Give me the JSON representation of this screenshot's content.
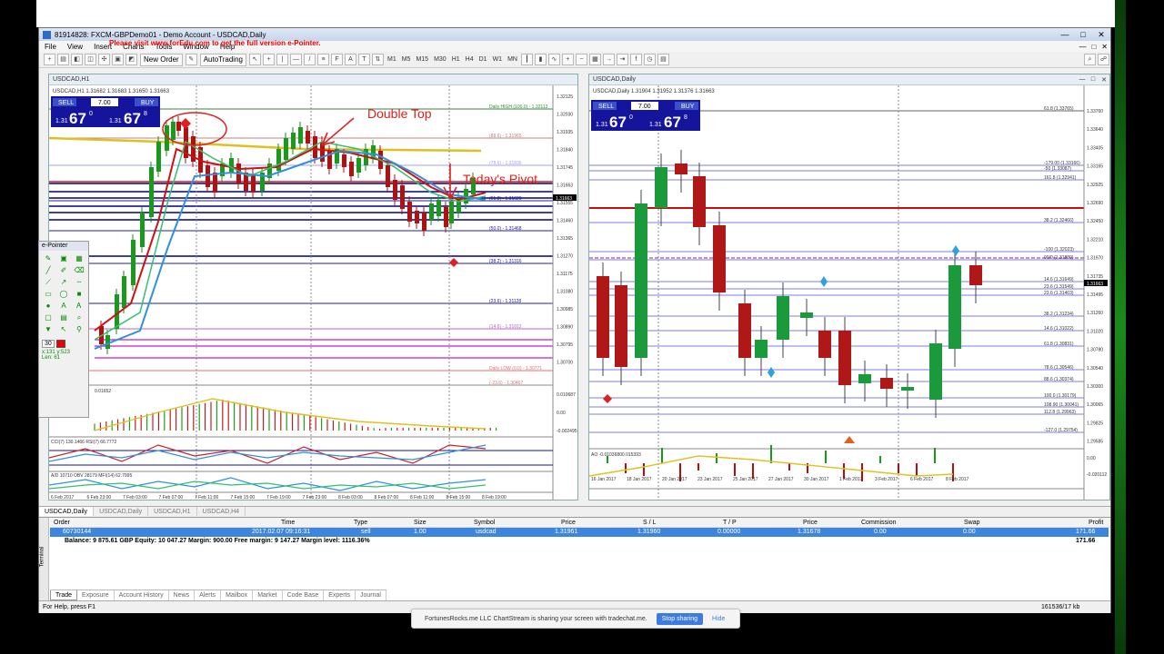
{
  "window": {
    "title": "81914828: FXCM-GBPDemo01 - Demo Account - USDCAD,Daily",
    "controls": [
      "—",
      "□",
      "✕"
    ]
  },
  "menu": [
    "File",
    "View",
    "Insert",
    "Charts",
    "Tools",
    "Window",
    "Help"
  ],
  "toolbar": {
    "new_order": "New Order",
    "auto_trading": "AutoTrading",
    "timeframes": [
      "M1",
      "M5",
      "M15",
      "M30",
      "H1",
      "H4",
      "D1",
      "W1",
      "MN"
    ]
  },
  "promo_text": "Please visit www.forEdu.com to get the full version e-Pointer.",
  "chart_h1": {
    "title": "USDCAD,H1",
    "symbol_label": "USDCAD,H1  1.31682 1.31683 1.31650 1.31663",
    "sell": "SELL",
    "buy": "BUY",
    "lot": "7.00",
    "sell_price_small": "1.31",
    "sell_price_big": "67",
    "sell_price_sup": "0",
    "buy_price_small": "1.31",
    "buy_price_big": "67",
    "buy_price_sup": "8",
    "annotation_double_top": "Double Top",
    "annotation_pivot": "Today's Pivot",
    "price_axis": [
      "1.32125",
      "1.32030",
      "1.31935",
      "1.31840",
      "1.31745",
      "1.31663",
      "1.31555",
      "1.31460",
      "1.31365",
      "1.31270",
      "1.31175",
      "1.31080",
      "1.30985",
      "1.30890",
      "1.30795",
      "1.30700"
    ],
    "level_labels": [
      "Daily HIGH (100.0) - 1.32113",
      "(88.6) - 1.31965",
      "(78.6) - 1.31836",
      "(61.8) - 1.31620",
      "(50.0) - 1.31468",
      "(38.2) - 1.31316",
      "(23.6) - 1.31128",
      "(14.6) - 1.31012",
      "Daily LOW (0.0) - 1.30771",
      "(-23.6) - 1.30467"
    ],
    "osc_label": "0.01652",
    "osc_axis": [
      "0.010687",
      "0.00",
      "-0.002495"
    ],
    "cci_label": "CCI(7) 130.1466  RSI(7) 66.7772",
    "obv_label": "A/D 10710  OBV 28179  MFI(14) 62.7995",
    "time_axis": [
      "6 Feb 2017",
      "6 Feb 23:00",
      "7 Feb 03:00",
      "7 Feb 07:00",
      "7 Feb 11:00",
      "7 Feb 15:00",
      "7 Feb 19:00",
      "7 Feb 23:00",
      "8 Feb 03:00",
      "8 Feb 07:00",
      "8 Feb 11:00",
      "8 Feb 15:00",
      "8 Feb 19:00"
    ]
  },
  "chart_daily": {
    "title": "USDCAD,Daily",
    "symbol_label": "USDCAD,Daily  1.31904 1.31952 1.31376 1.31663",
    "sell": "SELL",
    "buy": "BUY",
    "lot": "7.00",
    "sell_price_small": "1.31",
    "sell_price_big": "67",
    "sell_price_sup": "0",
    "buy_price_small": "1.31",
    "buy_price_big": "67",
    "buy_price_sup": "8",
    "price_axis": [
      "1.33760",
      "1.33640",
      "1.33405",
      "1.33165",
      "1.32925",
      "1.32690",
      "1.32450",
      "1.32210",
      "1.31970",
      "1.31735",
      "1.31495",
      "1.31260",
      "1.31020",
      "1.30780",
      "1.30540",
      "1.30300",
      "1.30065",
      "1.29825",
      "1.29585"
    ],
    "level_labels": [
      "61.8 (1.33765)",
      "-179.00 (1.33166)",
      "-50 (1.33087)",
      "161.8 (1.32941)",
      "38.2 (1.32466)",
      "-100 (1.32023)",
      "00/0 (1.31880)",
      "14.6 (1.31649)",
      "23.6 (1.31549)",
      "23.6 (1.31403)",
      "38.2 (1.31234)",
      "14.6 (1.31022)",
      "61.8 (1.30831)",
      "78.6 (1.30546)",
      "88.6 (1.30374)",
      "100.0 (1.30179)",
      "108.90 (1.30041)",
      "112.8 (1.29963)",
      "-127.0 (1.29754)"
    ],
    "ao_label": "AO -0.01036800.015393",
    "ao_axis": [
      "0.00",
      "-0.020112"
    ],
    "time_axis": [
      "16 Jan 2017",
      "18 Jan 2017",
      "20 Jan 2017",
      "23 Jan 2017",
      "25 Jan 2017",
      "27 Jan 2017",
      "30 Jan 2017",
      "1 Feb 2017",
      "3 Feb 2017",
      "6 Feb 2017",
      "8 Feb 2017"
    ]
  },
  "chart_tabs": [
    "USDCAD,Daily",
    "USDCAD,Daily",
    "USDCAD,H1",
    "USDCAD,H4"
  ],
  "terminal": {
    "columns": [
      "Order",
      "Time",
      "Type",
      "Size",
      "Symbol",
      "Price",
      "S / L",
      "T / P",
      "Price",
      "Commission",
      "Swap",
      "Profit"
    ],
    "order": {
      "order": "60730144",
      "time": "2017.02.07 09:16:31",
      "type": "sell",
      "size": "1.00",
      "symbol": "usdcad",
      "price": "1.31961",
      "sl": "1.31960",
      "tp": "0.00000",
      "cur_price": "1.31678",
      "commission": "0.00",
      "swap": "0.00",
      "profit": "171.66"
    },
    "balance_text": "Balance: 9 875.61 GBP  Equity: 10 047.27  Margin: 900.00  Free margin: 9 147.27  Margin level: 1116.36%",
    "balance_profit": "171.66",
    "tabs": [
      "Trade",
      "Exposure",
      "Account History",
      "News",
      "Alerts",
      "Mailbox",
      "Market",
      "Code Base",
      "Experts",
      "Journal"
    ],
    "side_label": "Terminal"
  },
  "status": {
    "help": "For Help, press F1",
    "traffic": "161536/17 kb"
  },
  "share_bar": {
    "message": "FortunesRocks.me LLC ChartStream is sharing your screen with tradechat.me.",
    "stop": "Stop sharing",
    "hide": "Hide"
  },
  "epointer": {
    "title": "e-Pointer",
    "size": "30",
    "coords": "x:131  y:523",
    "len": "Len: 61"
  }
}
